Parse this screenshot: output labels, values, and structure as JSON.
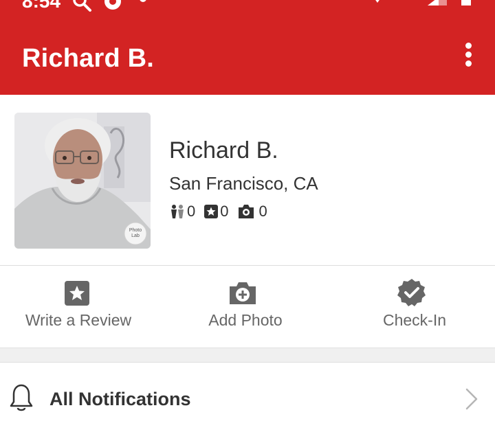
{
  "status_bar": {
    "time": "8:54"
  },
  "header": {
    "title": "Richard B.",
    "overflow_icon": "more-vertical-icon"
  },
  "profile": {
    "name": "Richard B.",
    "location": "San Francisco, CA",
    "stats": {
      "friends": "0",
      "reviews": "0",
      "photos": "0"
    },
    "avatar_watermark": "Photo Lab"
  },
  "actions": [
    {
      "label": "Write a Review",
      "icon": "star-box-icon"
    },
    {
      "label": "Add Photo",
      "icon": "camera-add-icon"
    },
    {
      "label": "Check-In",
      "icon": "check-badge-icon"
    }
  ],
  "menu": {
    "notifications_label": "All Notifications"
  },
  "colors": {
    "brand_red": "#d32323",
    "icon_gray": "#666666",
    "text_dark": "#333333"
  }
}
